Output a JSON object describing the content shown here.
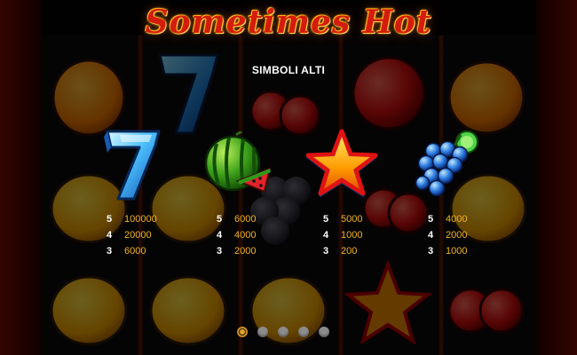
{
  "game": {
    "logo": "Sometimes Hot"
  },
  "paytable": {
    "title": "SIMBOLI ALTI",
    "symbols": [
      {
        "icon": "seven-icon",
        "payouts": [
          {
            "count": "5",
            "value": "100000"
          },
          {
            "count": "4",
            "value": "20000"
          },
          {
            "count": "3",
            "value": "6000"
          }
        ]
      },
      {
        "icon": "watermelon-icon",
        "payouts": [
          {
            "count": "5",
            "value": "6000"
          },
          {
            "count": "4",
            "value": "4000"
          },
          {
            "count": "3",
            "value": "2000"
          }
        ]
      },
      {
        "icon": "star-icon",
        "payouts": [
          {
            "count": "5",
            "value": "5000"
          },
          {
            "count": "4",
            "value": "1000"
          },
          {
            "count": "3",
            "value": "200"
          }
        ]
      },
      {
        "icon": "grapes-icon",
        "payouts": [
          {
            "count": "5",
            "value": "4000"
          },
          {
            "count": "4",
            "value": "2000"
          },
          {
            "count": "3",
            "value": "1000"
          }
        ]
      }
    ]
  },
  "pagination": {
    "total": 5,
    "current": 1
  },
  "colors": {
    "payout_value": "#f3b41c",
    "logo_red": "#d31c0c",
    "dot_active": "#e0a21f",
    "dot_inactive": "#8c8c8c"
  }
}
